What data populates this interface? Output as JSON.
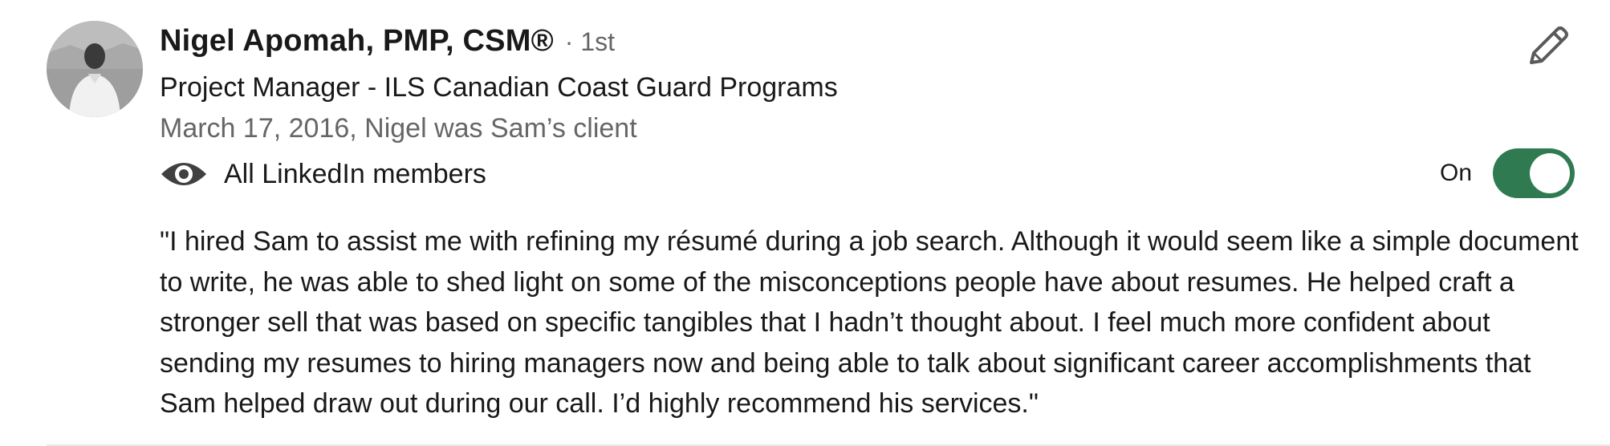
{
  "recommender": {
    "name": "Nigel Apomah, PMP, CSM®",
    "degree": "· 1st",
    "headline": "Project Manager - ILS Canadian Coast Guard Programs",
    "relation": "March 17, 2016, Nigel was Sam’s client"
  },
  "visibility": {
    "icon": "eye-icon",
    "label": "All LinkedIn members"
  },
  "toggle": {
    "label": "On",
    "state": true,
    "color": "#2f7a50"
  },
  "edit": {
    "icon": "pencil-icon"
  },
  "recommendation": {
    "text": "\"I hired Sam to assist me with refining my résumé during a job search. Although it would seem like a simple document to write, he was able to shed light on some of the misconceptions people have about resumes. He helped craft a stronger sell that was based on specific tangibles that I hadn’t thought about. I feel much more confident about sending my resumes to hiring managers now and being able to talk about significant career accomplishments that Sam helped draw out during our call. I’d highly recommend his services.\""
  }
}
